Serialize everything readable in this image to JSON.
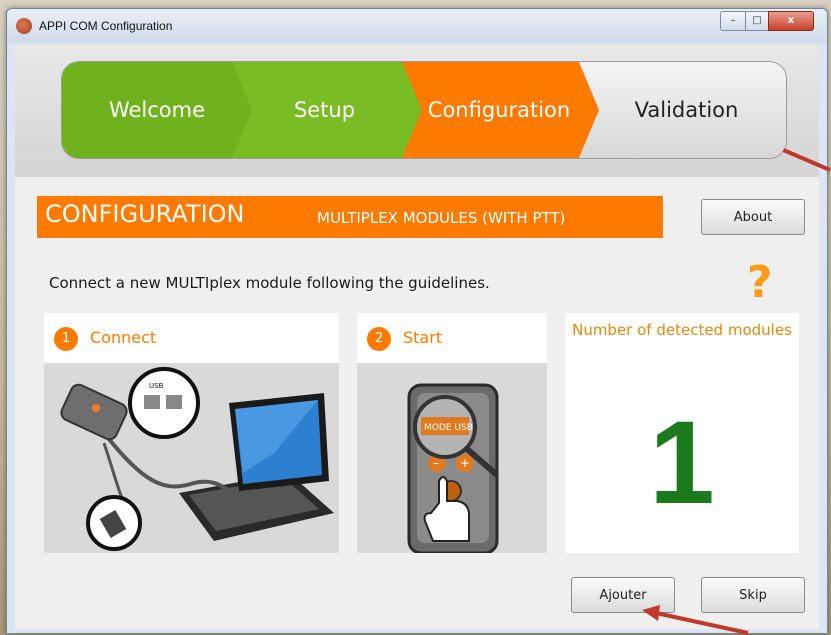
{
  "window": {
    "title": "APPI COM Configuration",
    "minimize": "–",
    "maximize": "□",
    "close": "x"
  },
  "steps": [
    {
      "label": "Welcome",
      "state": "done"
    },
    {
      "label": "Setup",
      "state": "done"
    },
    {
      "label": "Configuration",
      "state": "current"
    },
    {
      "label": "Validation",
      "state": "pending"
    }
  ],
  "section": {
    "title": "CONFIGURATION",
    "subtitle": "MULTIPLEX MODULES (WITH PTT)"
  },
  "about_label": "About",
  "instruction": "Connect a new MULTIplex module following the guidelines.",
  "help_icon": "?",
  "panels": {
    "connect": {
      "number": "1",
      "label": "Connect",
      "illustration": "laptop-usb-illustration"
    },
    "start": {
      "number": "2",
      "label": "Start",
      "illustration": "mode-usb-device-illustration",
      "device_text": "MODE USB"
    },
    "count": {
      "label": "Number of detected modules",
      "value": "1"
    }
  },
  "buttons": {
    "ajouter": "Ajouter",
    "skip": "Skip"
  },
  "colors": {
    "accent": "#ff7a00",
    "done": "#6fb21e",
    "count": "#1b7a1b",
    "arrow": "#c0392b"
  }
}
